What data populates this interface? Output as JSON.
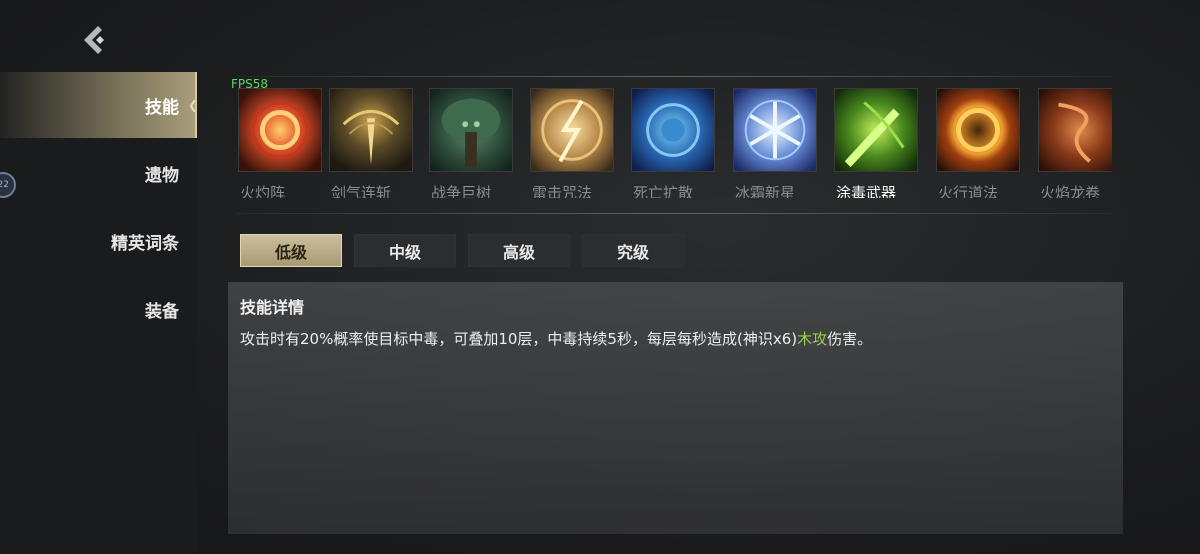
{
  "header": {
    "back_icon": "back-chevron-icon"
  },
  "overlay": {
    "fps": "FPS58"
  },
  "sidebar": {
    "items": [
      {
        "label": "技能",
        "active": true
      },
      {
        "label": "遗物",
        "active": false
      },
      {
        "label": "精英词条",
        "active": false
      },
      {
        "label": "装备",
        "active": false
      }
    ],
    "badge": "22"
  },
  "skills": [
    {
      "name": "火灼阵",
      "icon": "fire-ring-icon"
    },
    {
      "name": "剑气连斩",
      "icon": "sword-qi-icon"
    },
    {
      "name": "战争巨树",
      "icon": "war-tree-icon"
    },
    {
      "name": "雷击咒法",
      "icon": "lightning-icon"
    },
    {
      "name": "死亡扩散",
      "icon": "death-spread-icon"
    },
    {
      "name": "冰霜新星",
      "icon": "frost-nova-icon"
    },
    {
      "name": "涂毒武器",
      "icon": "poison-weapon-icon",
      "active": true
    },
    {
      "name": "火行道法",
      "icon": "fire-circle-icon"
    },
    {
      "name": "火焰龙卷",
      "icon": "fire-tornado-icon"
    }
  ],
  "levels": [
    {
      "label": "低级",
      "active": true
    },
    {
      "label": "中级",
      "active": false
    },
    {
      "label": "高级",
      "active": false
    },
    {
      "label": "究级",
      "active": false
    }
  ],
  "detail": {
    "title": "技能详情",
    "text_before": "攻击时有20%概率使目标中毒，可叠加10层，中毒持续5秒，每层每秒造成(神识x6)",
    "text_highlight": "木攻",
    "text_after": "伤害。",
    "highlight_color": "#9cd04a"
  }
}
